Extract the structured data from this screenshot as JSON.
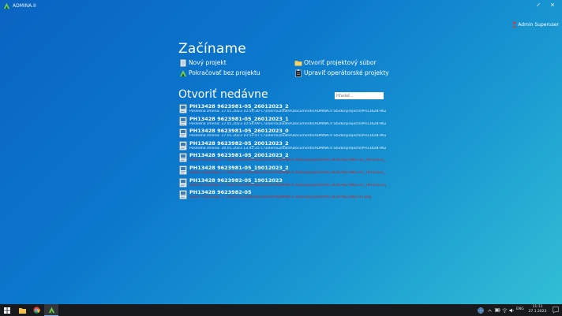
{
  "titlebar": {
    "app_title": "ADMINA.II",
    "minimize_icon": "minimize-icon",
    "close_icon": "close-icon"
  },
  "user": {
    "name": "Admin Superuser"
  },
  "start": {
    "heading": "Začíname",
    "new_project": "Nový projekt",
    "continue_without": "Pokračovať bez projektu",
    "open_file": "Otvoriť projektový súbor",
    "edit_operator": "Upraviť operátorské projekty"
  },
  "recent": {
    "heading": "Otvoriť nedávne",
    "search_placeholder": "Hľadať...",
    "items": [
      {
        "name": "PH13428 9623981-05_26012023_2",
        "path": "Posledná zmena: 27.01.2023 10:54:30 C:\\Users\\uzivatel\\Documents\\ADMINA.II Studio\\projects\\PH13428-9623981-05_26012023_2.proj",
        "missing": false
      },
      {
        "name": "PH13428 9623981-05_26012023_1",
        "path": "Posledná zmena: 27.01.2023 10:54:09 C:\\Users\\uzivatel\\Documents\\ADMINA.II Studio\\projects\\PH13428-9623981-05_26012023_1.proj",
        "missing": false
      },
      {
        "name": "PH13428 9623981-05_26012023_0",
        "path": "Posledná zmena: 27.01.2023 10:53:47 C:\\Users\\uzivatel\\Documents\\ADMINA.II Studio\\projects\\PH13428-9623981-05_26012023_0.proj",
        "missing": false
      },
      {
        "name": "PH13428 9623982-05_20012023_2",
        "path": "Posledná zmena: 20.01.2023 13:41:25 C:\\Users\\uzivatel\\Documents\\ADMINA.II Studio\\projects\\PH13428-9623982-05_20012023_2.proj",
        "missing": false
      },
      {
        "name": "PH13428 9623981-05_20012023_2",
        "path": "Súbor neexistuje: C:\\Users\\uzivatel\\Documents\\ADMINA.II Studio\\projects\\PH13428-9623981-05_20012023_2.proj",
        "missing": true
      },
      {
        "name": "PH13428 9623981-05_19012023_2",
        "path": "Súbor neexistuje: C:\\Users\\uzivatel\\Documents\\ADMINA.II Studio\\projects\\PH13428-9623981-05_19012023_2.proj",
        "missing": true
      },
      {
        "name": "PH13428 9623982-05_19012023",
        "path": "Súbor neexistuje: C:\\Users\\uzivatel\\Documents\\ADMINA.II Studio\\projects\\PH13428-9623982-05_19012023.proj",
        "missing": true
      },
      {
        "name": "PH13428 9623982-05",
        "path": "Súbor neexistuje: C:\\Users\\uzivatel\\Documents\\ADMINA.II Studio\\projects\\PH13428-9623982-05.proj",
        "missing": true
      }
    ]
  },
  "taskbar": {
    "language": "ENG",
    "time": "11:11",
    "date": "27.1.2023"
  },
  "colors": {
    "accent": "#0b78cc",
    "missing_path": "#d21f1f",
    "taskbar": "#17191c"
  }
}
